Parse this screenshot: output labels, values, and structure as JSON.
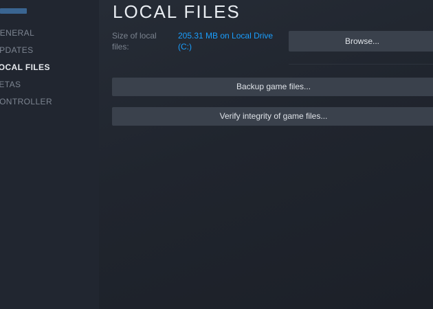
{
  "sidebar": {
    "items": [
      {
        "label": "GENERAL",
        "active": false
      },
      {
        "label": "UPDATES",
        "active": false
      },
      {
        "label": "LOCAL FILES",
        "active": true
      },
      {
        "label": "BETAS",
        "active": false
      },
      {
        "label": "CONTROLLER",
        "active": false
      }
    ]
  },
  "main": {
    "title": "LOCAL FILES",
    "size_label": "Size of local files:",
    "size_value": "205.31 MB on Local Drive (C:)",
    "browse_label": "Browse...",
    "backup_label": "Backup game files...",
    "verify_label": "Verify integrity of game files..."
  },
  "colors": {
    "background": "#1f232b",
    "sidebar": "#212630",
    "link": "#1a9fff",
    "button": "#3a414c",
    "active_nav": "#e8ebef",
    "inactive_nav": "#7d8591"
  }
}
